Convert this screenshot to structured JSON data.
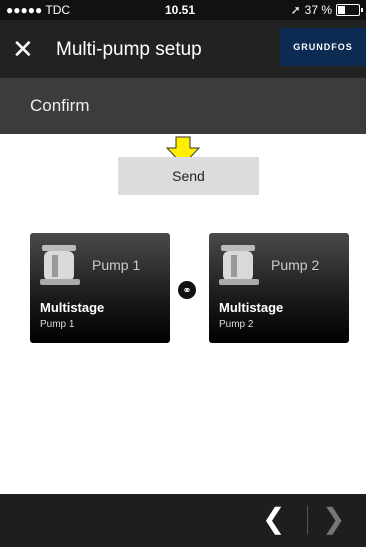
{
  "status_bar": {
    "carrier": "●●●●● TDC",
    "time": "10.51",
    "battery": "37 %",
    "battery_level": 0.37
  },
  "header": {
    "title": "Multi-pump setup",
    "brand": "GRUNDFOS"
  },
  "subheader": {
    "title": "Confirm"
  },
  "actions": {
    "send_label": "Send"
  },
  "pumps": [
    {
      "name": "Pump 1",
      "type": "Multistage",
      "sub": "Pump 1"
    },
    {
      "name": "Pump 2",
      "type": "Multistage",
      "sub": "Pump 2"
    }
  ],
  "colors": {
    "accent_arrow": "#ffee00",
    "brand_bg": "#0b2b52"
  }
}
